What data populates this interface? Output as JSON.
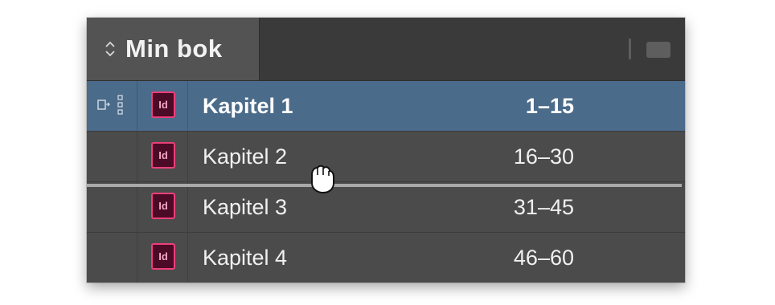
{
  "panel": {
    "title": "Min bok",
    "icons": {
      "tab": "up-down-arrows-icon",
      "menu": "panel-menu-icon",
      "doc": "indesign-document-icon",
      "sync": "sync-source-icon",
      "cursor": "grab-hand-cursor-icon"
    }
  },
  "documents": [
    {
      "name": "Kapitel 1",
      "pages": "1–15",
      "selected": true
    },
    {
      "name": "Kapitel 2",
      "pages": "16–30"
    },
    {
      "name": "Kapitel 3",
      "pages": "31–45"
    },
    {
      "name": "Kapitel 4",
      "pages": "46–60"
    }
  ],
  "icon_text": "Id",
  "colors": {
    "selection": "#4a6b8a",
    "indesign_accent": "#ee3f7a"
  }
}
